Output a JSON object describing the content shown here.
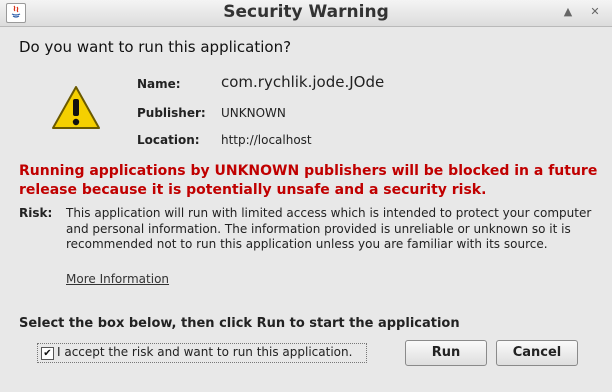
{
  "window": {
    "title": "Security Warning"
  },
  "question": "Do you want to run this application?",
  "details": {
    "name_label": "Name:",
    "name_value": "com.rychlik.jode.JOde",
    "publisher_label": "Publisher:",
    "publisher_value": "UNKNOWN",
    "location_label": "Location:",
    "location_value": "http://localhost"
  },
  "warning_text": "Running applications by UNKNOWN publishers will be blocked in a future release because it is potentially unsafe and a security risk.",
  "risk": {
    "label": "Risk:",
    "text": "This application will run with limited access which is intended to protect your computer and personal information. The information provided is unreliable or unknown so it is recommended not to run this application unless you are familiar with its source.",
    "more_link": "More Information"
  },
  "instruction": "Select the box below, then click Run to start the application",
  "accept": {
    "label": "I accept the risk and want to run this application.",
    "checked": true
  },
  "buttons": {
    "run": "Run",
    "cancel": "Cancel"
  },
  "colors": {
    "warning_red": "#c00000",
    "icon_yellow": "#f5d000"
  }
}
